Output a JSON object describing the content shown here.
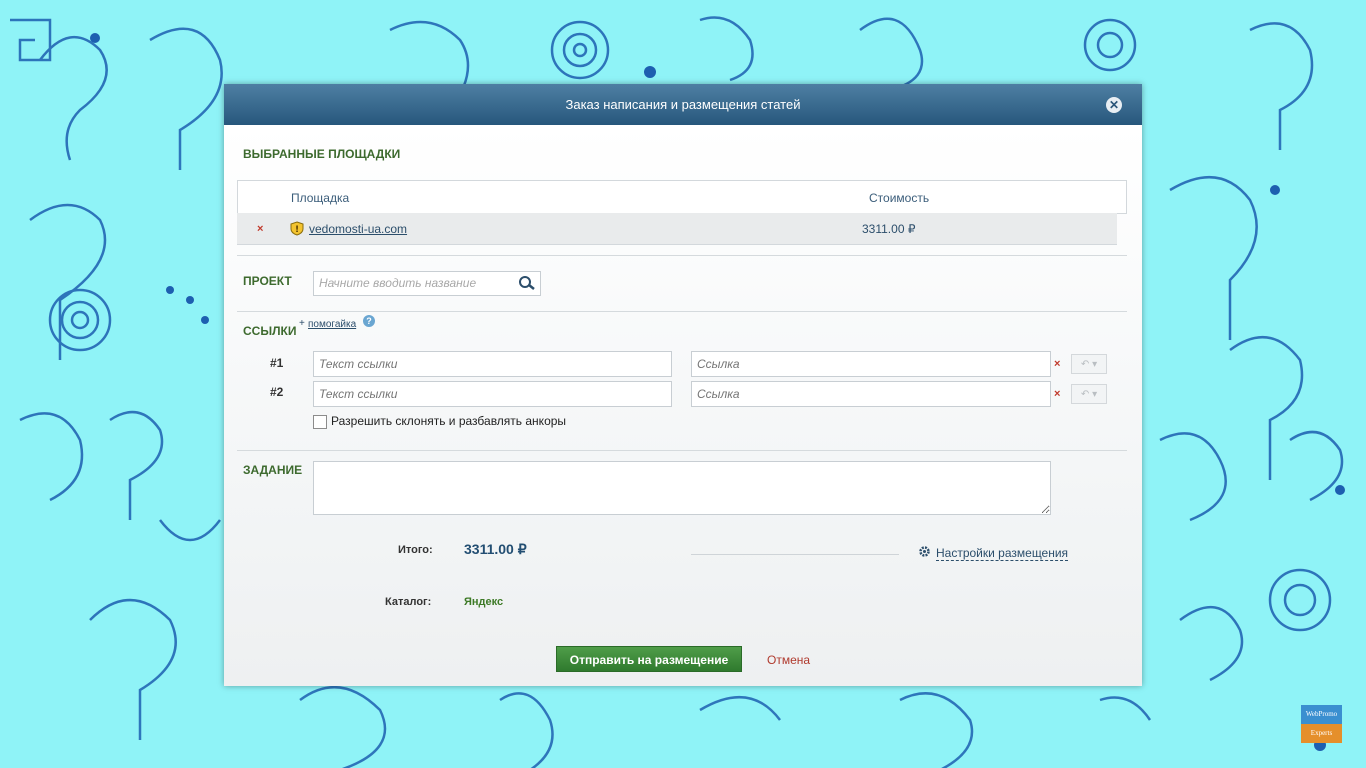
{
  "modal": {
    "title": "Заказ написания и размещения статей",
    "close_icon": "close-icon"
  },
  "sections": {
    "selected_sites": "ВЫБРАННЫЕ ПЛОЩАДКИ",
    "project": "ПРОЕКТ",
    "links": "ССЫЛКИ",
    "task": "ЗАДАНИЕ"
  },
  "sites_table": {
    "columns": [
      "Площадка",
      "Стоимость"
    ],
    "rows": [
      {
        "remove": "×",
        "site": "vedomosti-ua.com",
        "price": "3311.00 ₽"
      }
    ]
  },
  "project": {
    "placeholder": "Начните вводить название"
  },
  "links": {
    "helper_plus": "+",
    "helper_link": "помогайка",
    "help_icon": "?",
    "rows": [
      {
        "num": "#1",
        "text_placeholder": "Текст ссылки",
        "url_placeholder": "Ссылка",
        "remove": "×",
        "undo": "↶ ▾"
      },
      {
        "num": "#2",
        "text_placeholder": "Текст ссылки",
        "url_placeholder": "Ссылка",
        "remove": "×",
        "undo": "↶ ▾"
      }
    ],
    "checkbox_label": "Разрешить склонять и разбавлять анкоры"
  },
  "summary": {
    "total_label": "Итого:",
    "total_value": "3311.00 ₽",
    "settings_link": "Настройки размещения",
    "catalog_label": "Каталог:",
    "catalog_value": "Яндекс"
  },
  "actions": {
    "submit": "Отправить на размещение",
    "cancel": "Отмена"
  },
  "logo": {
    "line1": "WebPromo",
    "line2": "Experts"
  }
}
